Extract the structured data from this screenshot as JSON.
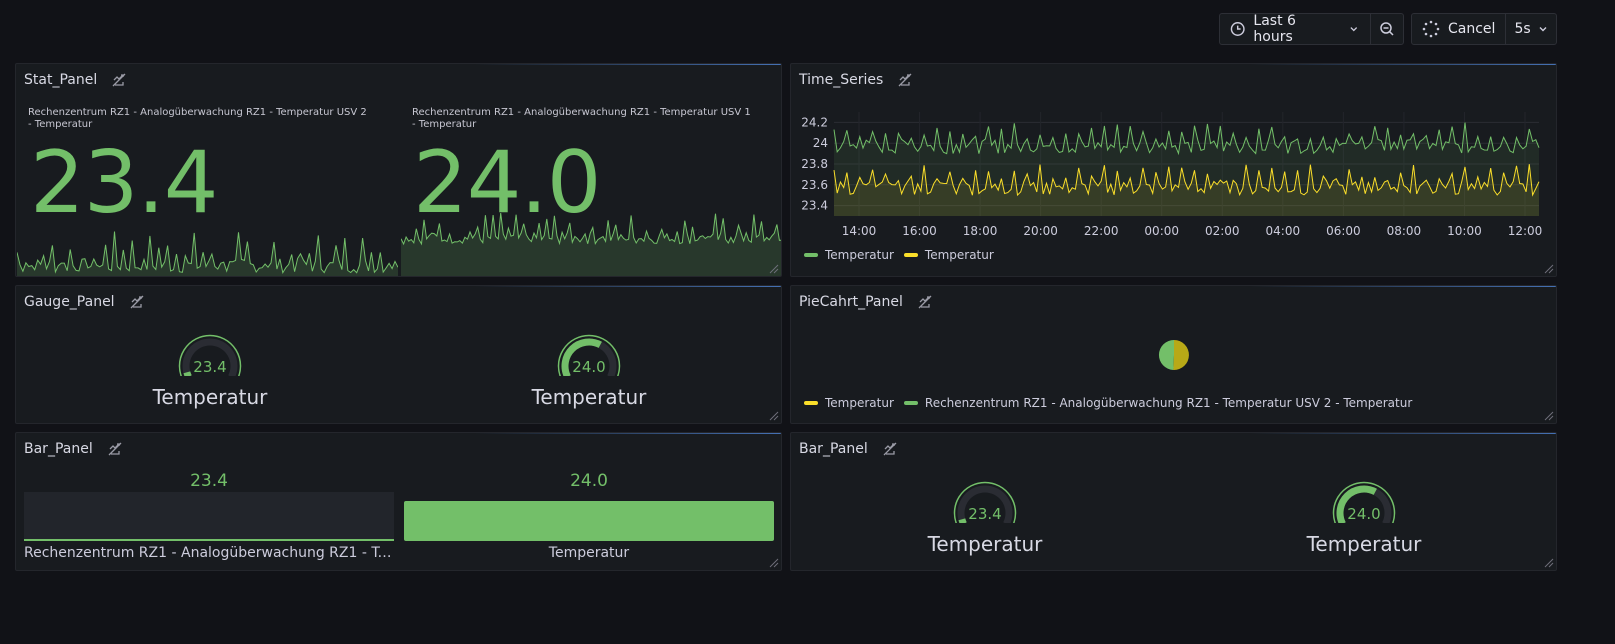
{
  "toolbar": {
    "time_range_label": "Last 6 hours",
    "cancel_label": "Cancel",
    "refresh_interval": "5s"
  },
  "colors": {
    "green": "#73bf69",
    "yellow": "#fade2a",
    "olive": "#b8a917",
    "background": "#111217",
    "panel": "#181b1f"
  },
  "stat_panel": {
    "title": "Stat_Panel",
    "items": [
      {
        "label": "Rechenzentrum RZ1 - Analogüberwachung RZ1 - Temperatur USV 2 - Temperatur",
        "value": "23.4"
      },
      {
        "label": "Rechenzentrum RZ1 - Analogüberwachung RZ1 - Temperatur USV 1 - Temperatur",
        "value": "24.0"
      }
    ]
  },
  "time_series": {
    "title": "Time_Series",
    "legend": [
      "Temperatur",
      "Temperatur"
    ]
  },
  "chart_data": {
    "type": "line",
    "x_ticks": [
      "14:00",
      "16:00",
      "18:00",
      "20:00",
      "22:00",
      "00:00",
      "02:00",
      "04:00",
      "06:00",
      "08:00",
      "10:00",
      "12:00"
    ],
    "y_ticks": [
      "24.2",
      "24",
      "23.8",
      "23.6",
      "23.4"
    ],
    "ylim": [
      23.3,
      24.3
    ],
    "series": [
      {
        "name": "Temperatur",
        "color": "#73bf69",
        "min": 23.8,
        "max": 24.2
      },
      {
        "name": "Temperatur",
        "color": "#fade2a",
        "min": 23.4,
        "max": 23.8
      }
    ]
  },
  "gauge_panel": {
    "title": "Gauge_Panel",
    "gauges": [
      {
        "value": "23.4",
        "label": "Temperatur",
        "fraction": 0.05
      },
      {
        "value": "24.0",
        "label": "Temperatur",
        "fraction": 0.62
      }
    ]
  },
  "pie_panel": {
    "title": "PieCahrt_Panel",
    "slices": [
      {
        "name": "Temperatur",
        "color": "#b8a917",
        "value": 24.0
      },
      {
        "name": "Rechenzentrum RZ1 - Analogüberwachung RZ1 - Temperatur USV 2 - Temperatur",
        "color": "#73bf69",
        "value": 23.4
      }
    ],
    "legend": [
      {
        "label": "Temperatur",
        "color": "#fade2a"
      },
      {
        "label": "Rechenzentrum RZ1 - Analogüberwachung RZ1 - Temperatur USV 2 - Temperatur",
        "color": "#73bf69"
      }
    ]
  },
  "bar_panel_left": {
    "title": "Bar_Panel",
    "bars": [
      {
        "value": "23.4",
        "name": "Rechenzentrum RZ1 - Analogüberwachung RZ1 - Tem...",
        "fraction": 0.04
      },
      {
        "value": "24.0",
        "name": "Temperatur",
        "fraction": 0.82
      }
    ]
  },
  "bar_panel_right": {
    "title": "Bar_Panel",
    "gauges": [
      {
        "value": "23.4",
        "label": "Temperatur",
        "fraction": 0.05
      },
      {
        "value": "24.0",
        "label": "Temperatur",
        "fraction": 0.62
      }
    ]
  }
}
